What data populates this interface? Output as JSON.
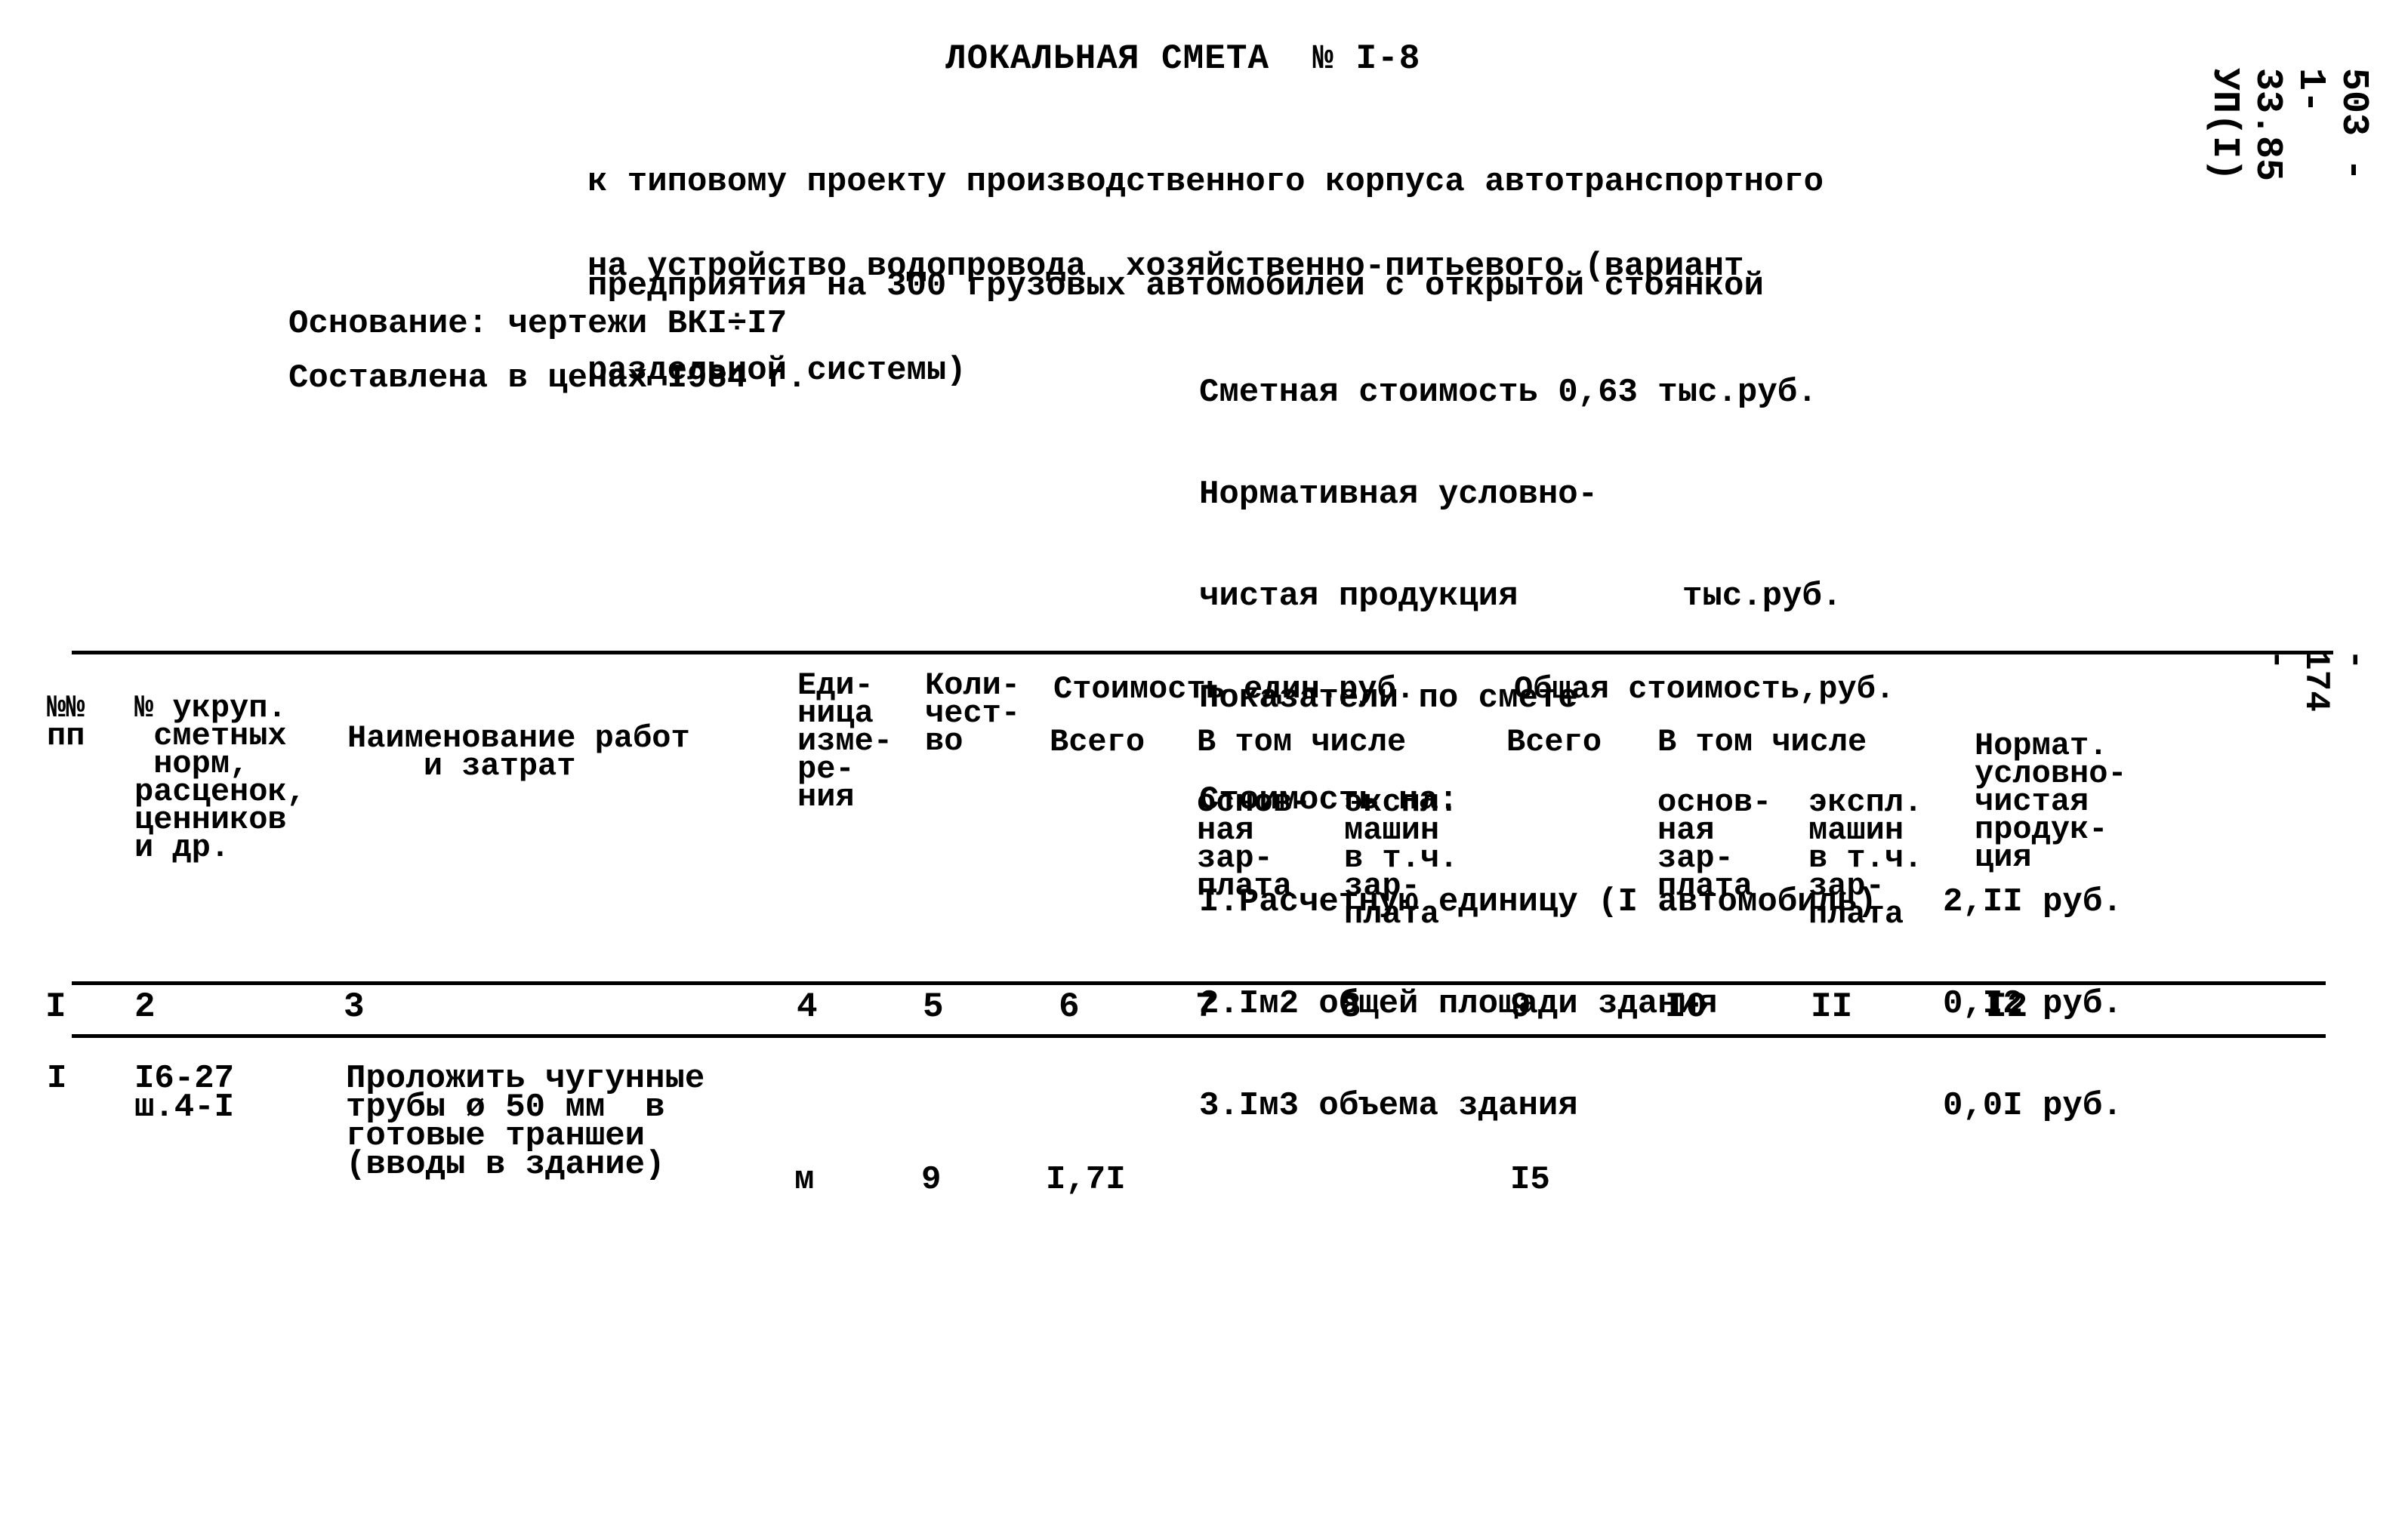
{
  "document": {
    "title": "ЛОКАЛЬНАЯ СМЕТА  № I-8",
    "subtitle_lines": [
      "к типовому проекту производственного корпуса автотранспортного",
      "предприятия на 300 грузовых автомобилей с открытой стоянкой"
    ],
    "purpose_lines": [
      "на устройство водопровода  хозяйственно-питьевого (вариант",
      "раздельной системы)"
    ],
    "side_code": "503 - 1-33.85 УП(I)",
    "page_number": "- 174 -"
  },
  "basis": {
    "drawings": "Основание: чертежи ВКI÷I7",
    "prices": "Составлена в ценах I984 г."
  },
  "cost_summary": {
    "estimated_cost_label": "Сметная стоимость 0,63 тыс.руб.",
    "normative_label_1": "Нормативная условно-",
    "normative_label_2": "чистая продукция",
    "normative_unit": "тыс.руб.",
    "indicators_label": "Показатели по смете",
    "cost_per_label": "Стоимость на:",
    "indicators": [
      {
        "label": "I.Расчетную единицу (I автомобиль)",
        "value": "2,II руб."
      },
      {
        "label": "2.Iм2 общей площади здания",
        "value": "0,I2 руб."
      },
      {
        "label": "3.Iм3 объема здания",
        "value": "0,0I руб."
      }
    ]
  },
  "table": {
    "headers": {
      "num": "№№\nпп",
      "code": "№ укруп.\n сметных\n норм,\nрасценок,\nценников\nи др.",
      "name": "Наименование работ\n    и затрат",
      "unit": "Еди-\nница\nизме-\nре-\nния",
      "qty": "Коли-\nчест-\nво",
      "unit_cost_group": "Стоимость един.руб.",
      "unit_cost_total": "Всего",
      "unit_cost_incl": "В том числе",
      "unit_cost_wage": "основ-\nная\nзар-\nплата",
      "unit_cost_mach": "экспл.\nмашин\nв т.ч.\nзар-\nплата",
      "total_group": "Общая стоимость,руб.",
      "total_all": "Всего",
      "total_incl": "В том числе",
      "total_wage": "основ-\nная\nзар-\nплата",
      "total_mach": "экспл.\nмашин\nв т.ч.\nзар-\nплата",
      "normative": "Нормат.\nусловно-\nчистая\nпродук-\nция"
    },
    "column_numbers": [
      "I",
      "2",
      "3",
      "4",
      "5",
      "6",
      "7",
      "8",
      "9",
      "I0",
      "II",
      "I2"
    ],
    "rows": [
      {
        "num": "I",
        "code": "I6-27\nш.4-I",
        "name": "Проложить чугунные\nтрубы ø 50 мм  в\nготовые траншеи\n(вводы в здание)",
        "unit": "м",
        "qty": "9",
        "unit_cost_total": "I,7I",
        "unit_cost_wage": "",
        "unit_cost_mach": "",
        "total_all": "I5",
        "total_wage": "",
        "total_mach": "",
        "normative": ""
      }
    ]
  }
}
